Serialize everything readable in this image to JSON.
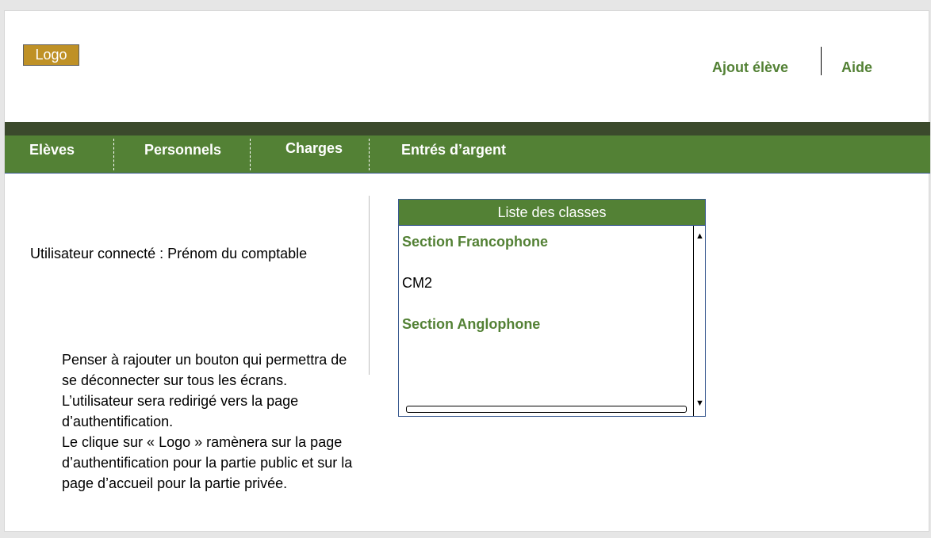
{
  "header": {
    "logo_label": "Logo",
    "links": [
      "Ajout élève",
      "Aide"
    ]
  },
  "nav": {
    "items": [
      "Elèves",
      "Personnels",
      "Charges",
      "Entrés d’argent"
    ]
  },
  "user": {
    "connected_text": "Utilisateur connecté : Prénom du comptable"
  },
  "note": {
    "text": "Penser à rajouter un bouton qui permettra de se déconnecter sur tous les écrans. L’utilisateur sera redirigé vers la page d’authentification.\n Le clique sur « Logo » ramènera sur la page d’authentification pour la partie public et sur la page d’accueil pour la partie privée."
  },
  "classes": {
    "title": "Liste des classes",
    "items": [
      "Section Francophone",
      "CM2",
      "Section Anglophone"
    ]
  },
  "colors": {
    "accent_green": "#538135",
    "dark_band": "#3b4a2c",
    "logo_bg": "#bf9126"
  },
  "icons": {
    "scroll_up": "triangle-up-icon",
    "scroll_down": "triangle-down-icon"
  }
}
